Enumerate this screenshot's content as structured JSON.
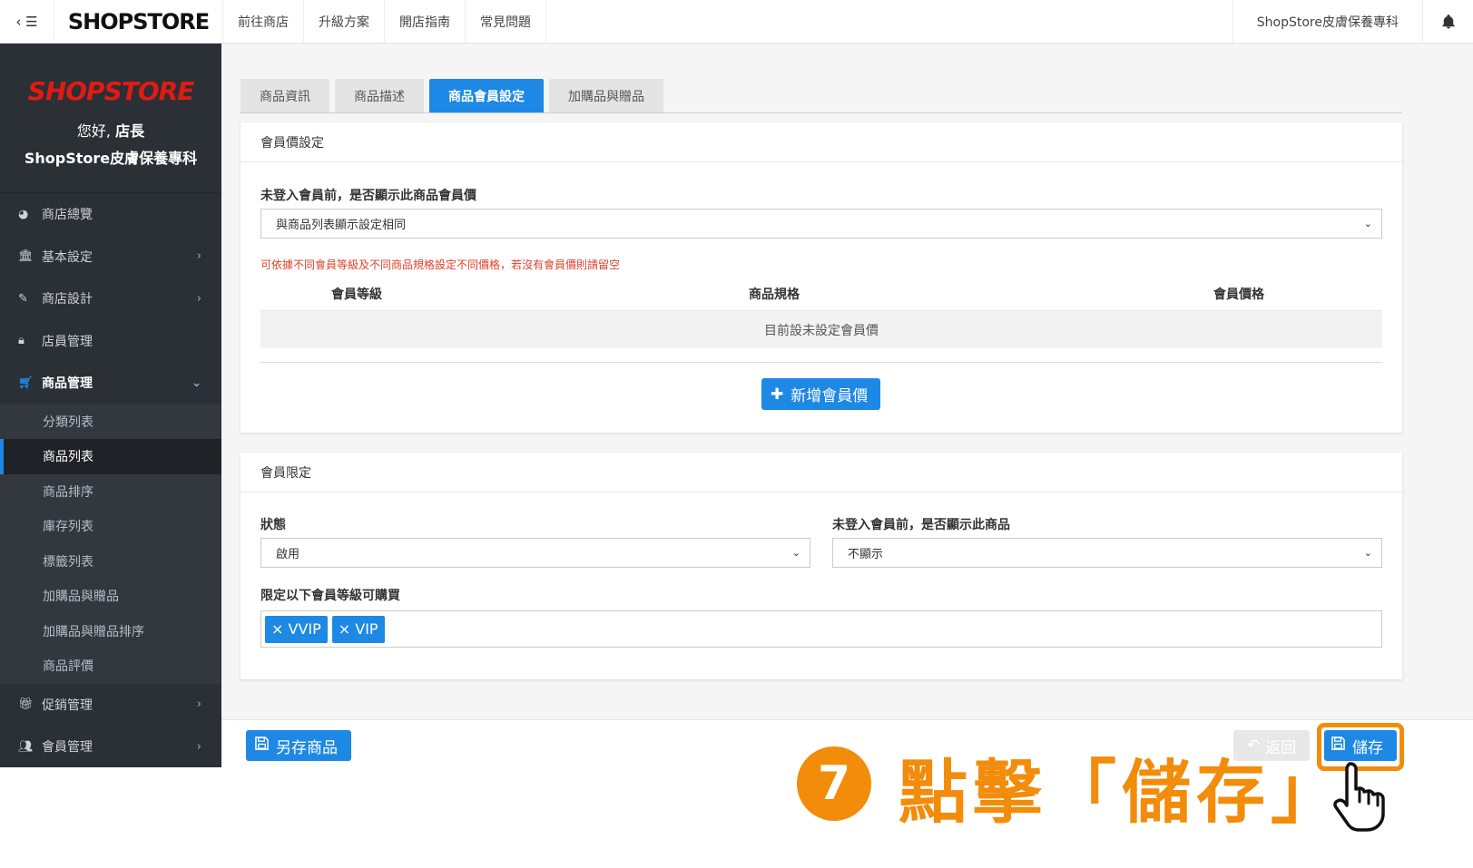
{
  "topbar": {
    "toggle_icon": "‹ ☰",
    "logo": "SHOPSTORE",
    "nav": [
      "前往商店",
      "升級方案",
      "開店指南",
      "常見問題"
    ],
    "store_name": "ShopStore皮膚保養專科",
    "bell_icon": "bell-icon"
  },
  "sidebar": {
    "logo": "SHOPSTORE",
    "greeting_prefix": "您好,",
    "greeting_name": "店長",
    "store_name": "ShopStore皮膚保養專科",
    "items": [
      {
        "label": "商店總覽",
        "icon": "dashboard-icon"
      },
      {
        "label": "基本設定",
        "icon": "bank-icon"
      },
      {
        "label": "商店設計",
        "icon": "magic-wand-icon"
      },
      {
        "label": "店員管理",
        "icon": "lock-icon"
      },
      {
        "label": "商品管理",
        "icon": "cart-icon"
      },
      {
        "label": "促銷管理",
        "icon": "gift-icon"
      },
      {
        "label": "會員管理",
        "icon": "users-icon"
      }
    ],
    "sub_items": [
      "分類列表",
      "商品列表",
      "商品排序",
      "庫存列表",
      "標籤列表",
      "加購品與贈品",
      "加購品與贈品排序",
      "商品評價"
    ]
  },
  "tabs": [
    "商品資訊",
    "商品描述",
    "商品會員設定",
    "加購品與贈品"
  ],
  "member_price": {
    "title": "會員價設定",
    "field_label": "未登入會員前，是否顯示此商品會員價",
    "select_value": "與商品列表顯示設定相同",
    "hint": "可依據不同會員等級及不同商品規格設定不同價格，若沒有會員價則請留空",
    "headers": [
      "會員等級",
      "商品規格",
      "會員價格"
    ],
    "empty_text": "目前設未設定會員價",
    "add_button": "新增會員價"
  },
  "member_limit": {
    "title": "會員限定",
    "status_label": "狀態",
    "status_value": "啟用",
    "show_label": "未登入會員前，是否顯示此商品",
    "show_value": "不顯示",
    "levels_label": "限定以下會員等級可購買",
    "tags": [
      "× VVIP",
      "× VIP"
    ]
  },
  "footer": {
    "save_as": "另存商品",
    "back": "返回",
    "save": "儲存"
  },
  "annotation": {
    "step": "7",
    "text": "點擊「儲存」"
  },
  "colors": {
    "primary": "#1e88e5",
    "sidebar": "#2b2f36",
    "brand_red": "#e01b12",
    "annotation": "#f28c0a",
    "hint": "#e0402a"
  }
}
